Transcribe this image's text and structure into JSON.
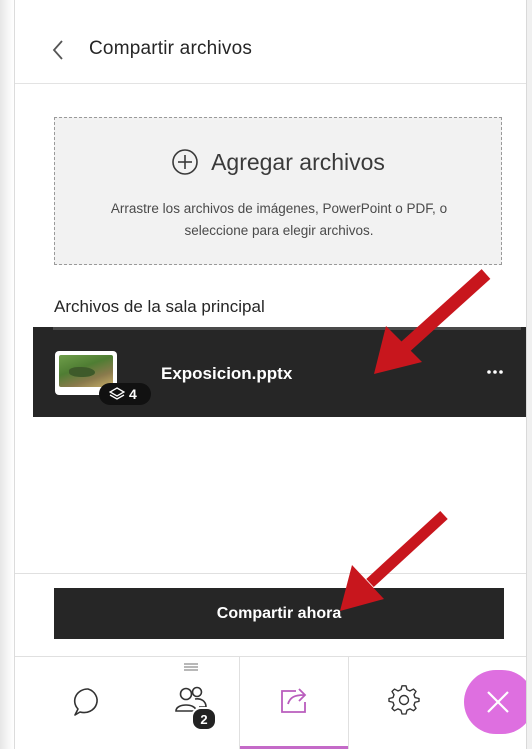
{
  "header": {
    "title": "Compartir archivos",
    "back_icon": "chevron-left-icon"
  },
  "dropzone": {
    "add_label": "Agregar archivos",
    "add_icon": "plus-circle-icon",
    "hint": "Arrastre los archivos de imágenes, PowerPoint o PDF, o seleccione para elegir archivos."
  },
  "files_section": {
    "title": "Archivos de la sala principal",
    "files": [
      {
        "name": "Exposicion.pptx",
        "slide_count": "4",
        "thumbnail_icon": "presentation-thumbnail",
        "badge_icon": "layers-icon",
        "menu_icon": "more-options-icon"
      }
    ]
  },
  "share_button": {
    "label": "Compartir ahora"
  },
  "bottom_nav": {
    "items": [
      {
        "name": "chat",
        "icon": "chat-bubble-icon"
      },
      {
        "name": "attendees",
        "icon": "people-icon",
        "badge": "2"
      },
      {
        "name": "share-content",
        "icon": "share-icon",
        "active": true
      },
      {
        "name": "settings",
        "icon": "gear-icon"
      },
      {
        "name": "close",
        "icon": "close-icon"
      }
    ]
  },
  "annotations": {
    "arrow_color": "#c8161d"
  },
  "colors": {
    "dark": "#262626",
    "accent": "#de6fe0",
    "active_indicator": "#c46ac8"
  }
}
